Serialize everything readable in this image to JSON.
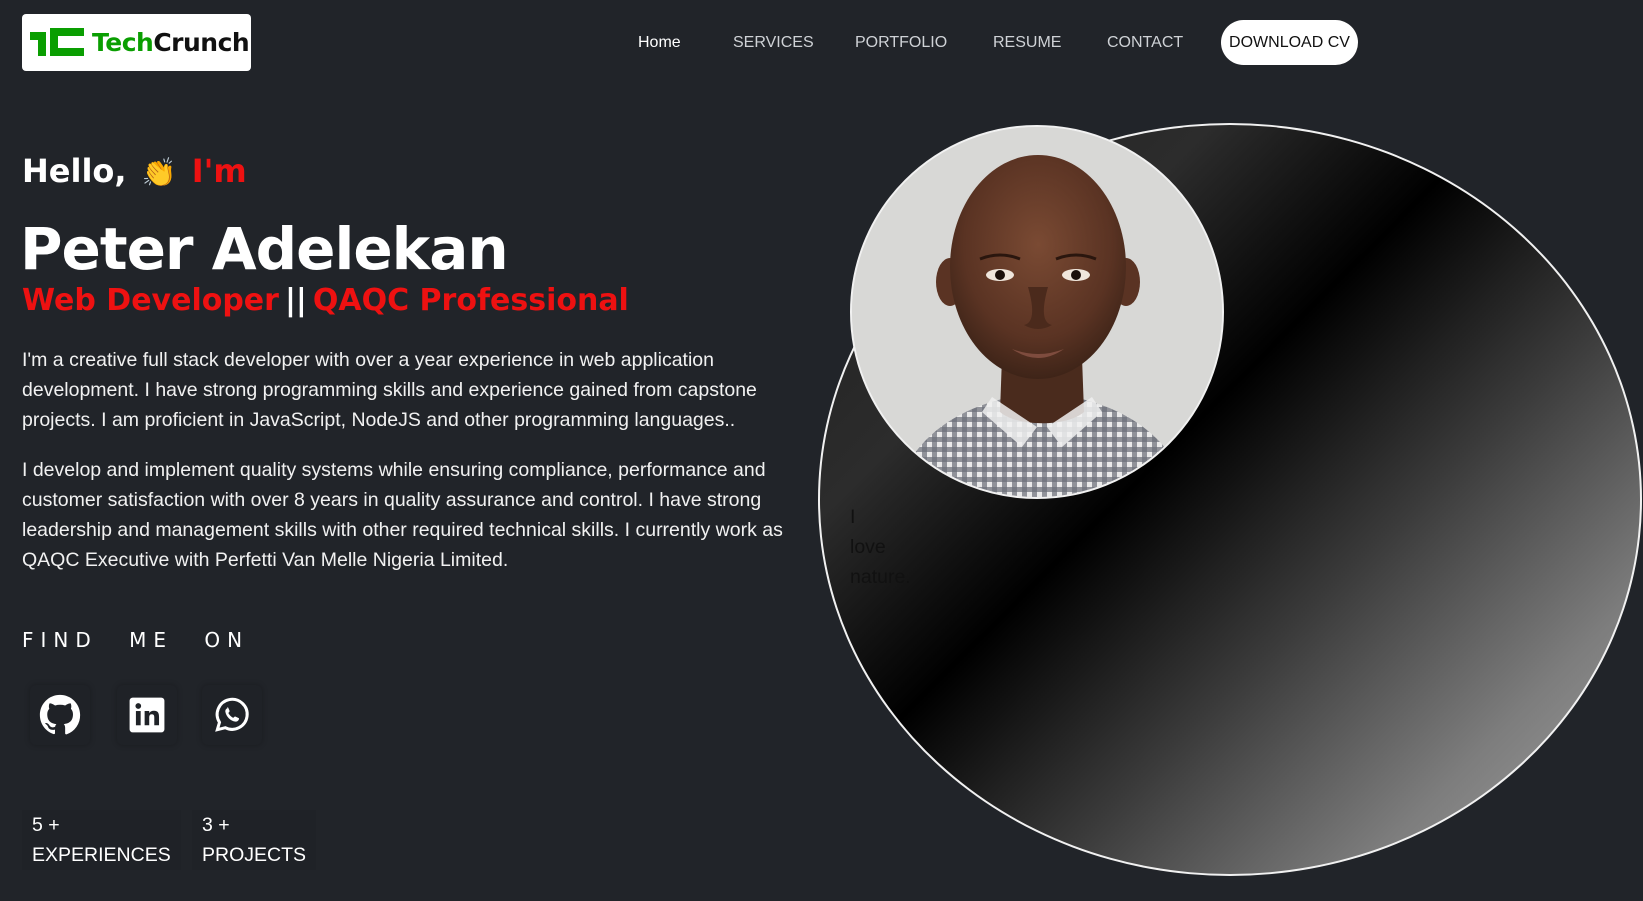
{
  "logo": {
    "part1": "Tech",
    "part2": "Crunch",
    "icon": "techcrunch-logo-icon",
    "icon_color": "#0a9e01"
  },
  "nav": {
    "items": [
      {
        "label": "Home",
        "active": true
      },
      {
        "label": "SERVICES"
      },
      {
        "label": "PORTFOLIO"
      },
      {
        "label": "RESUME"
      },
      {
        "label": "CONTACT"
      }
    ],
    "cv_button": "DOWNLOAD CV"
  },
  "hero": {
    "greeting": "Hello,",
    "wave_emoji": "👏",
    "im": "I'm",
    "name": "Peter Adelekan",
    "role1": "Web Developer",
    "separator": "||",
    "role2": "QAQC Professional",
    "para1": "I'm a creative full stack developer with over a year experience in web application development. I have strong programming skills and experience gained from capstone projects. I am proficient in JavaScript, NodeJS and other programming languages..",
    "para2": "I develop and implement quality systems while ensuring compliance, performance and customer satisfaction with over 8 years in quality assurance and control. I have strong leadership and management skills with other required technical skills. I currently work as QAQC Executive with Perfetti Van Melle Nigeria Limited."
  },
  "find_me": "FIND ME ON",
  "socials": [
    {
      "icon": "github-icon"
    },
    {
      "icon": "linkedin-icon"
    },
    {
      "icon": "whatsapp-icon"
    }
  ],
  "stats": [
    {
      "value": "5 +",
      "label": "EXPERIENCES"
    },
    {
      "value": "3 +",
      "label": "PROJECTS"
    }
  ],
  "visual": {
    "caption_line1": "I",
    "caption_line2": "love",
    "caption_line3": "nature."
  },
  "colors": {
    "background": "#212429",
    "accent": "#ee1111",
    "text": "#ffffff"
  }
}
